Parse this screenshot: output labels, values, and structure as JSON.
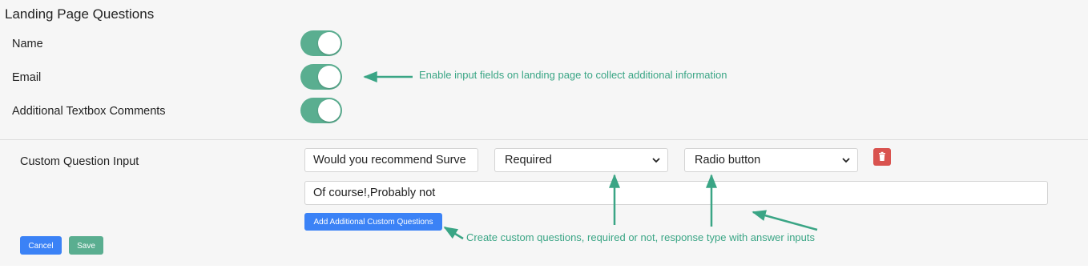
{
  "section_title": "Landing Page Questions",
  "toggles": [
    {
      "label": "Name",
      "enabled": true
    },
    {
      "label": "Email",
      "enabled": true
    },
    {
      "label": "Additional Textbox Comments",
      "enabled": true
    }
  ],
  "custom_question": {
    "label": "Custom Question Input",
    "question_value": "Would you recommend Surve",
    "required_select": "Required",
    "type_select": "Radio button",
    "answers_value": "Of course!,Probably not",
    "add_button": "Add Additional Custom Questions"
  },
  "actions": {
    "cancel": "Cancel",
    "save": "Save"
  },
  "annotations": {
    "toggle_note": "Enable input fields on landing page to collect additional information",
    "custom_note": "Create custom questions, required or not, response type with answer inputs"
  },
  "colors": {
    "toggle_on": "#5aae90",
    "primary": "#3b82f6",
    "danger": "#d9534f",
    "annotation": "#3aa585"
  },
  "icons": [
    "chevron-down-icon",
    "trash-icon",
    "arrow-icon"
  ]
}
